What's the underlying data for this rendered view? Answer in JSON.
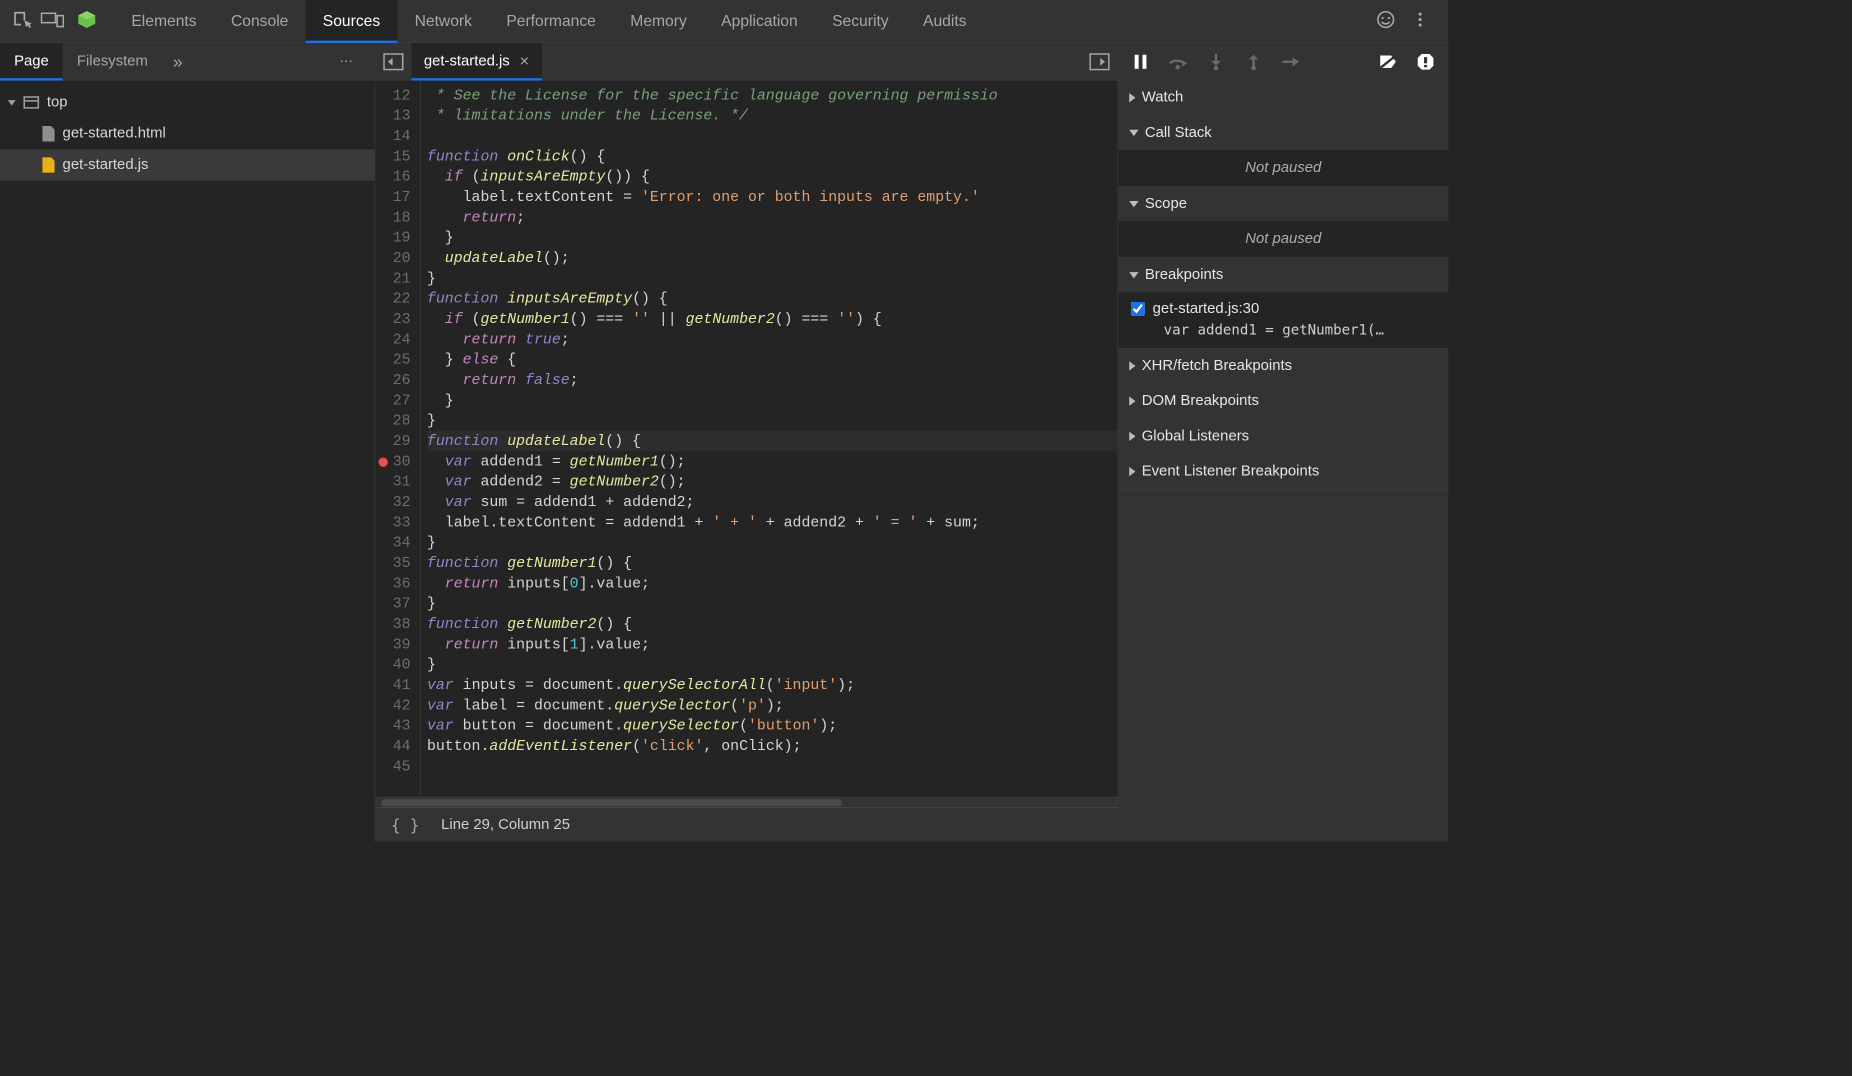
{
  "topbar": {
    "tabs": [
      "Elements",
      "Console",
      "Sources",
      "Network",
      "Performance",
      "Memory",
      "Application",
      "Security",
      "Audits"
    ],
    "active": "Sources"
  },
  "leftNav": {
    "tabs": [
      "Page",
      "Filesystem"
    ],
    "active": "Page",
    "tree_top": "top",
    "files": [
      {
        "name": "get-started.html",
        "type": "doc",
        "selected": false
      },
      {
        "name": "get-started.js",
        "type": "js",
        "selected": true
      }
    ]
  },
  "editor": {
    "openFile": "get-started.js",
    "startLine": 12,
    "highlightLine": 29,
    "breakpoints": [
      30
    ],
    "lines": [
      {
        "n": 12,
        "html": " <span class='cm'>* See the License for the specific language governing permissio</span>"
      },
      {
        "n": 13,
        "html": " <span class='cm'>* limitations under the License. */</span>"
      },
      {
        "n": 14,
        "html": ""
      },
      {
        "n": 15,
        "html": "<span class='kw'>function</span> <span class='fn'>onClick</span>() {"
      },
      {
        "n": 16,
        "html": "  <span class='kw2'>if</span> (<span class='fn'>inputsAreEmpty</span>()) {"
      },
      {
        "n": 17,
        "html": "    label.textContent = <span class='str'>'Error: one or both inputs are empty.'</span>"
      },
      {
        "n": 18,
        "html": "    <span class='kw2'>return</span>;"
      },
      {
        "n": 19,
        "html": "  }"
      },
      {
        "n": 20,
        "html": "  <span class='fn'>updateLabel</span>();"
      },
      {
        "n": 21,
        "html": "}"
      },
      {
        "n": 22,
        "html": "<span class='kw'>function</span> <span class='fn'>inputsAreEmpty</span>() {"
      },
      {
        "n": 23,
        "html": "  <span class='kw2'>if</span> (<span class='fn'>getNumber1</span>() === <span class='str'>''</span> || <span class='fn'>getNumber2</span>() === <span class='str'>''</span>) {"
      },
      {
        "n": 24,
        "html": "    <span class='kw2'>return</span> <span class='kw'>true</span>;"
      },
      {
        "n": 25,
        "html": "  } <span class='kw2'>else</span> {"
      },
      {
        "n": 26,
        "html": "    <span class='kw2'>return</span> <span class='kw'>false</span>;"
      },
      {
        "n": 27,
        "html": "  }"
      },
      {
        "n": 28,
        "html": "}"
      },
      {
        "n": 29,
        "html": "<span class='kw'>function</span> <span class='fn'>updateLabel</span>() {"
      },
      {
        "n": 30,
        "html": "  <span class='kw'>var</span> addend1 = <span class='fn'>getNumber1</span>();"
      },
      {
        "n": 31,
        "html": "  <span class='kw'>var</span> addend2 = <span class='fn'>getNumber2</span>();"
      },
      {
        "n": 32,
        "html": "  <span class='kw'>var</span> sum = addend1 + addend2;"
      },
      {
        "n": 33,
        "html": "  label.textContent = addend1 + <span class='str'>' + '</span> + addend2 + <span class='str'>' = '</span> + sum;"
      },
      {
        "n": 34,
        "html": "}"
      },
      {
        "n": 35,
        "html": "<span class='kw'>function</span> <span class='fn'>getNumber1</span>() {"
      },
      {
        "n": 36,
        "html": "  <span class='kw2'>return</span> inputs[<span class='num'>0</span>].value;"
      },
      {
        "n": 37,
        "html": "}"
      },
      {
        "n": 38,
        "html": "<span class='kw'>function</span> <span class='fn'>getNumber2</span>() {"
      },
      {
        "n": 39,
        "html": "  <span class='kw2'>return</span> inputs[<span class='num'>1</span>].value;"
      },
      {
        "n": 40,
        "html": "}"
      },
      {
        "n": 41,
        "html": "<span class='kw'>var</span> inputs = document.<span class='fn'>querySelectorAll</span>(<span class='str'>'input'</span>);"
      },
      {
        "n": 42,
        "html": "<span class='kw'>var</span> label = document.<span class='fn'>querySelector</span>(<span class='str'>'p'</span>);"
      },
      {
        "n": 43,
        "html": "<span class='kw'>var</span> button = document.<span class='fn'>querySelector</span>(<span class='str'>'button'</span>);"
      },
      {
        "n": 44,
        "html": "button.<span class='fn'>addEventListener</span>(<span class='str'>'click'</span>, onClick);"
      },
      {
        "n": 45,
        "html": ""
      }
    ]
  },
  "status": {
    "cursor": "Line 29, Column 25"
  },
  "debugger": {
    "notPaused": "Not paused",
    "sections": {
      "watch": "Watch",
      "callstack": "Call Stack",
      "scope": "Scope",
      "breakpoints": "Breakpoints",
      "xhr": "XHR/fetch Breakpoints",
      "dom": "DOM Breakpoints",
      "global": "Global Listeners",
      "event": "Event Listener Breakpoints"
    },
    "bp_list": [
      {
        "checked": true,
        "label": "get-started.js:30",
        "preview": "var addend1 = getNumber1(…"
      }
    ]
  }
}
